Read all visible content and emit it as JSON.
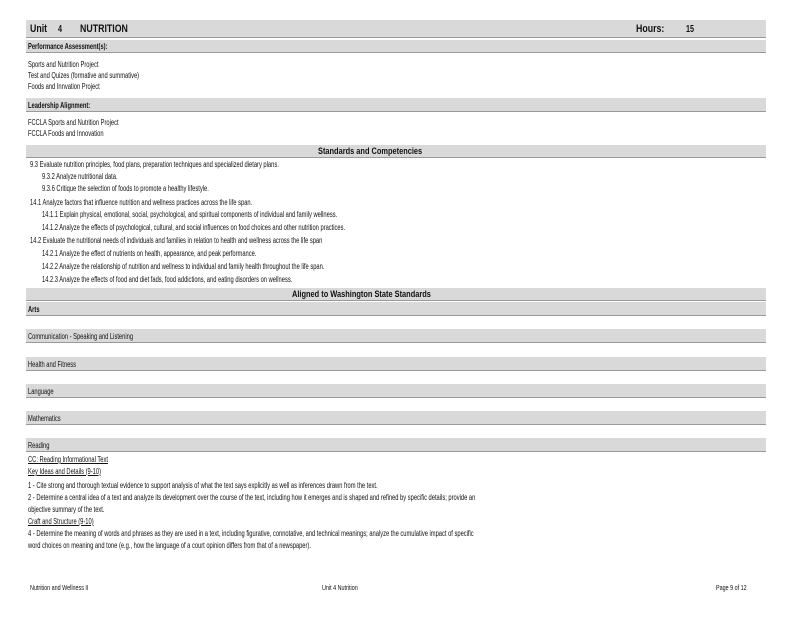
{
  "header": {
    "unit_label": "Unit",
    "unit_number": "4",
    "unit_title": "NUTRITION",
    "hours_label": "Hours:",
    "hours_value": "15"
  },
  "performance": {
    "heading": "Performance Assessment(s):",
    "items": [
      "Sports and Nutrition Project",
      "Test and Quizes (formative and summative)",
      "Foods and Innvation Project"
    ]
  },
  "leadership": {
    "heading": "Leadership Alignment:",
    "items": [
      "FCCLA Sports and Nutrition Project",
      "FCCLA Foods and Innovation"
    ]
  },
  "standards": {
    "heading": "Standards and Competencies",
    "items": [
      "9.3 Evaluate nutrition principles, food plans, preparation techniques and specialized dietary plans.",
      "9.3.2 Analyze nutritional data.",
      "9.3.6 Critique the selection of foods to promote a healthy lifestyle.",
      "14.1 Analyze factors that influence nutrition and wellness practices across the life span.",
      "14.1.1 Explain physical, emotional, social, psychological, and spiritual components of individual and family wellness.",
      "14.1.2 Analyze the effects of psychological, cultural, and social influences on food choices and other nutrition practices.",
      "14.2 Evaluate the nutritional needs of individuals and families in relation to health and wellness across the life span",
      "14.2.1 Analyze the effect of nutrients on health, appearance, and peak performance.",
      "14.2.2 Analyze the relationship of nutrition and wellness to individual and family health throughout the life span.",
      "14.2.3 Analyze the effects of food and diet fads, food addictions, and eating disorders on wellness."
    ]
  },
  "aligned": {
    "heading": "Aligned to Washington State Standards",
    "sections": {
      "arts": "Arts",
      "communication": "Communication - Speaking and Listening",
      "health": "Health and Fitness",
      "language": "Language",
      "mathematics": "Mathematics",
      "reading": "Reading"
    }
  },
  "reading": {
    "cc": "CC: Reading Informational Text",
    "key_ideas": "Key Ideas and Details (9-10)",
    "item1": "1 - Cite strong and thorough textual evidence to support analysis of what the text says explicitly as well as inferences drawn from the text.",
    "item2a": "2 - Determine a central idea of a text and analyze its development over the course of the text, including how it emerges and is shaped and refined by specific details; provide an",
    "item2b": "objective summary of the text.",
    "craft": "Craft and Structure (9-10)",
    "item4a": "4 - Determine the meaning of words and phrases as they are used in a text, including figurative, connotative, and technical meanings; analyze the cumulative impact of specific",
    "item4b": "word choices on meaning and tone (e.g., how the language of a court opinion differs from that of a newspaper)."
  },
  "footer": {
    "left": "Nutrition and Wellness II",
    "center": "Unit 4 Nutrition",
    "right": "Page 9 of 12"
  }
}
